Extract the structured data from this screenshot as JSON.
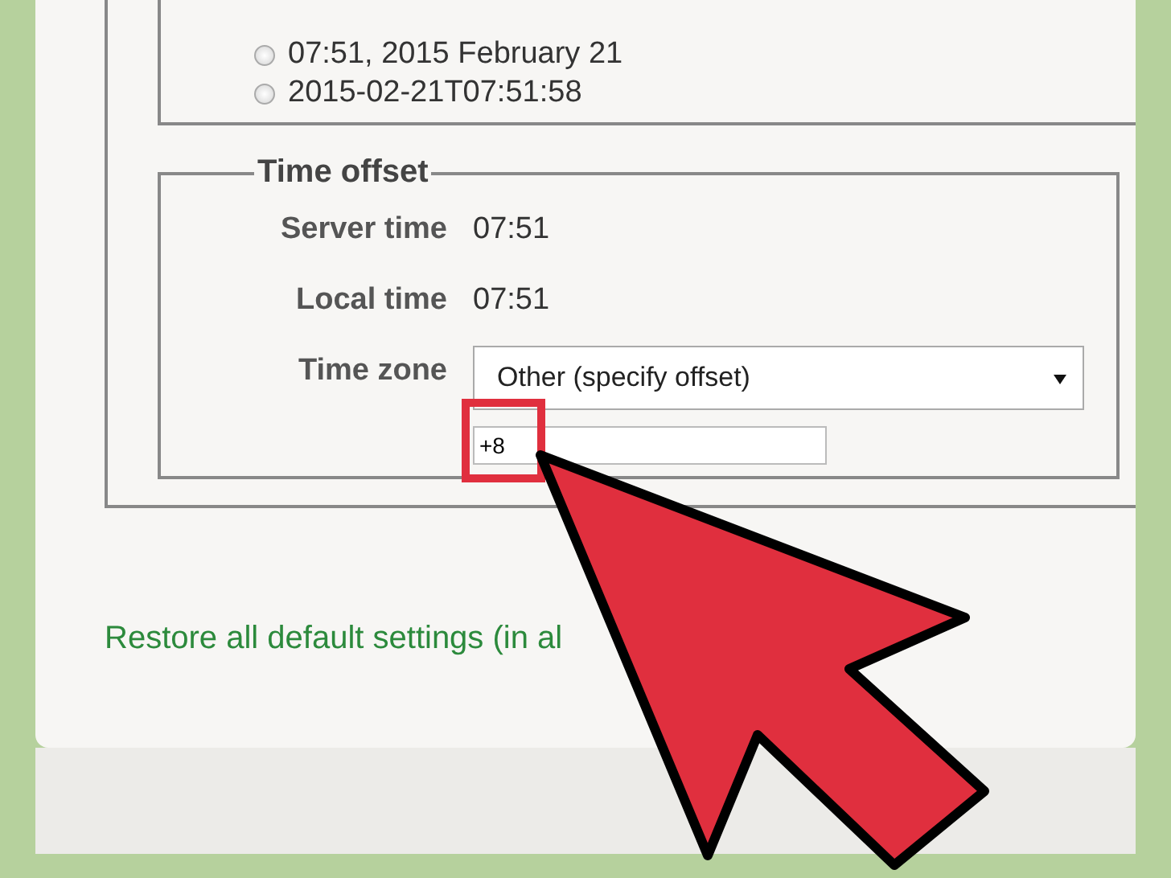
{
  "date_formats": [
    {
      "label": "07:51, 2015 February 21",
      "selected": false
    },
    {
      "label": "2015-02-21T07:51:58",
      "selected": false
    }
  ],
  "time_offset": {
    "legend": "Time offset",
    "rows": [
      {
        "label": "Server time",
        "kind": "text",
        "value": "07:51"
      },
      {
        "label": "Local time",
        "kind": "text",
        "value": "07:51"
      },
      {
        "label": "Time zone",
        "kind": "select",
        "value": "Other (specify offset)",
        "offset": "+8"
      }
    ]
  },
  "restore_link": "Restore all default settings (in al"
}
